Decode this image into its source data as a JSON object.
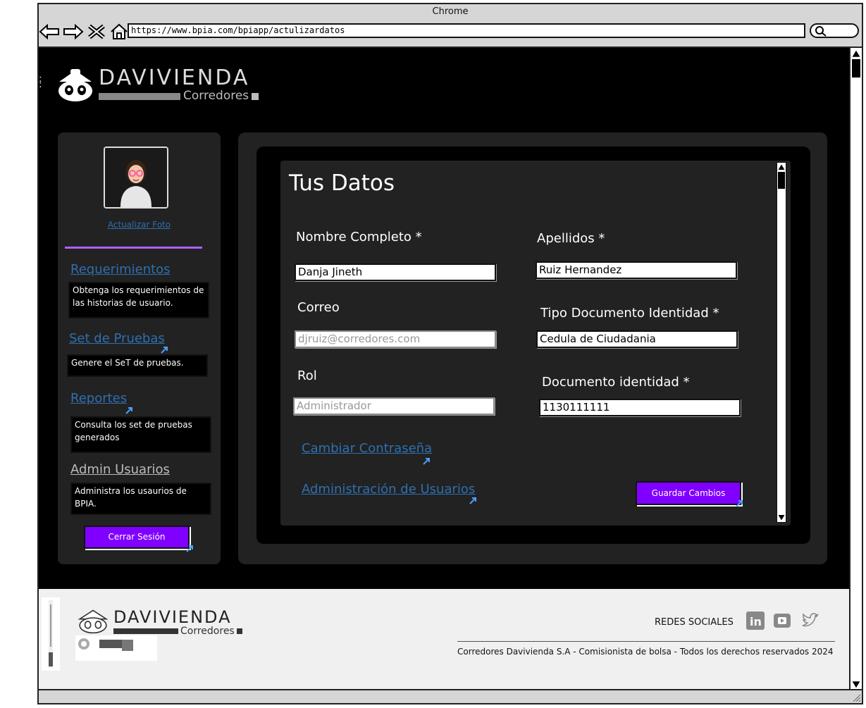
{
  "browser": {
    "title": "Chrome",
    "url": "https://www.bpia.com/bpiapp/actulizardatos"
  },
  "brand": {
    "name": "DAVIVIENDA",
    "sub": "Corredores"
  },
  "sidebar": {
    "photo_link": "Actualizar Foto",
    "items": [
      {
        "label": "Requerimientos",
        "desc": "Obtenga los requerimientos de las historias de usuario."
      },
      {
        "label": "Set de Pruebas",
        "desc": "Genere el SeT de pruebas."
      },
      {
        "label": "Reportes",
        "desc": "Consulta los set de pruebas generados"
      },
      {
        "label": "Admin Usuarios",
        "desc": "Administra los usaurios de BPIA."
      }
    ],
    "logout": "Cerrar Sesión"
  },
  "form": {
    "title": "Tus Datos",
    "nombre_label": "Nombre Completo *",
    "nombre_value": "Danja Jineth",
    "apellidos_label": "Apellidos *",
    "apellidos_value": "Ruiz Hernandez",
    "correo_label": "Correo",
    "correo_value": "djruiz@corredores.com",
    "tipo_doc_label": "Tipo Documento Identidad *",
    "tipo_doc_value": "Cedula de Ciudadania",
    "rol_label": "Rol",
    "rol_value": "Administrador",
    "doc_label": "Documento identidad *",
    "doc_value": "1130111111",
    "cambiar_link": "Cambiar Contraseña",
    "admin_link": "Administración de Usuarios",
    "save": "Guardar Cambios"
  },
  "footer": {
    "redes": "REDES SOCIALES",
    "copyright": "Corredores Davivienda S.A - Comisionista de bolsa - Todos los derechos reservados 2024",
    "social_icons": [
      "linkedin-icon",
      "youtube-icon",
      "twitter-icon"
    ]
  },
  "colors": {
    "accent": "#8000ff",
    "link": "#2f6fb0",
    "panel": "#222222"
  }
}
